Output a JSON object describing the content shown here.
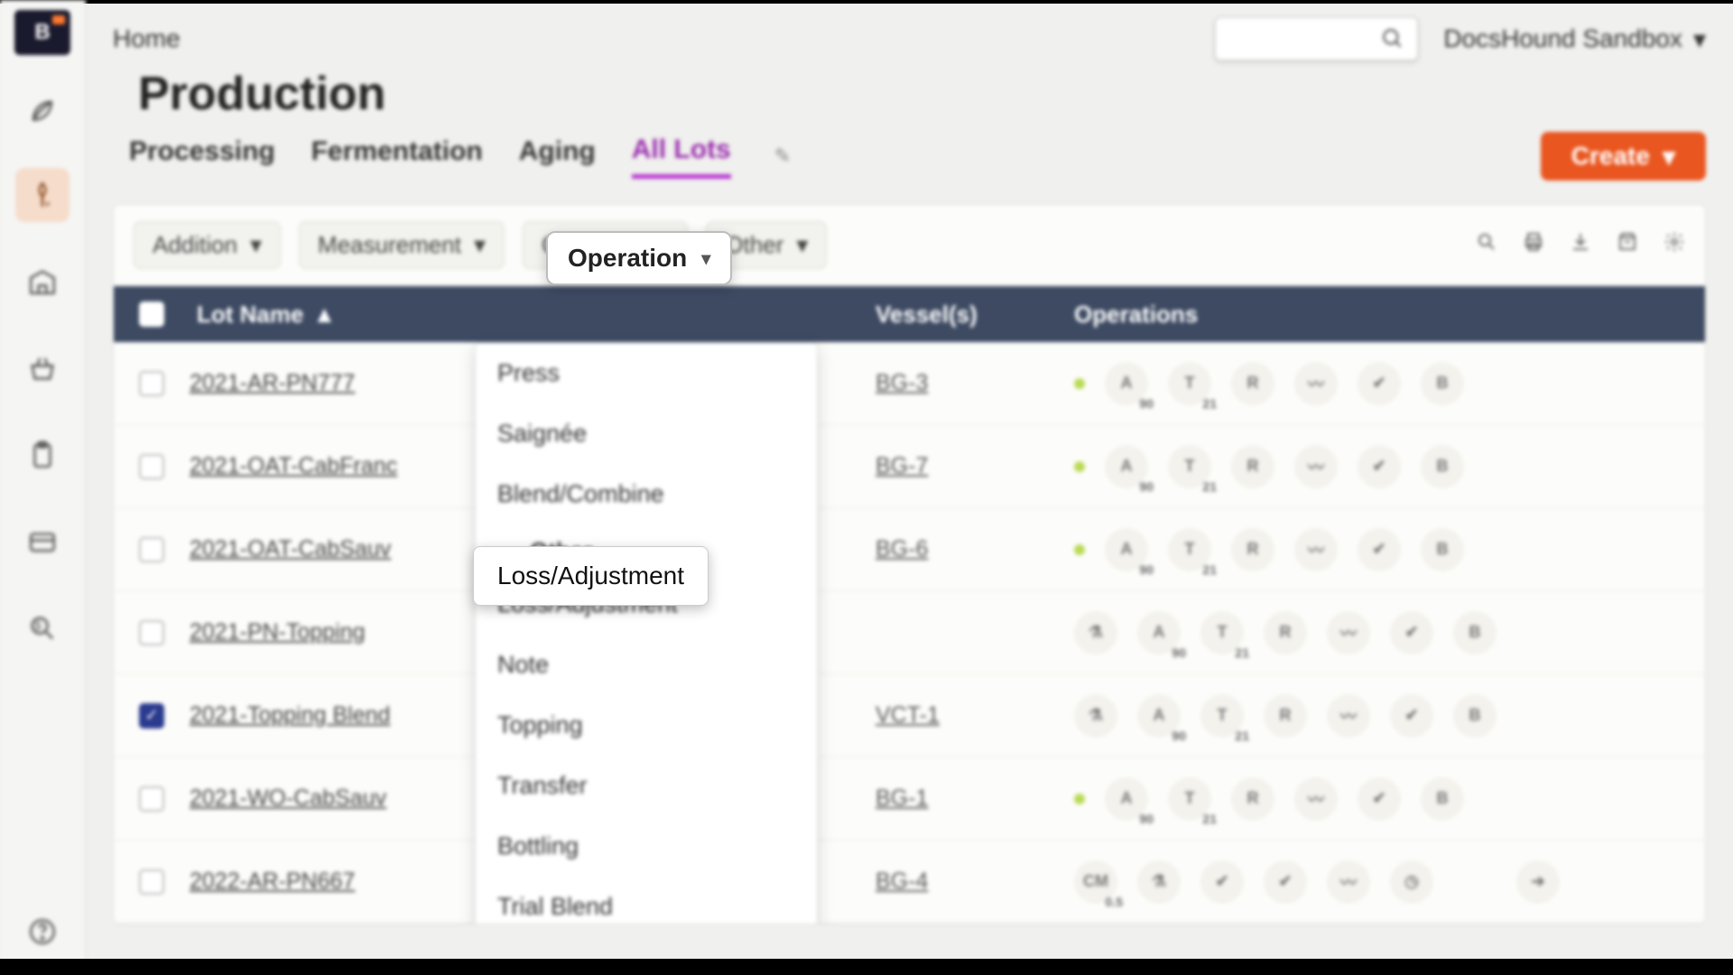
{
  "breadcrumb": "Home",
  "page_title": "Production",
  "org": {
    "name": "DocsHound Sandbox"
  },
  "search": {
    "placeholder": ""
  },
  "tabs": [
    {
      "label": "Processing",
      "active": false
    },
    {
      "label": "Fermentation",
      "active": false
    },
    {
      "label": "Aging",
      "active": false
    },
    {
      "label": "All Lots",
      "active": true
    }
  ],
  "create_button": "Create",
  "filters": {
    "addition": "Addition",
    "measurement": "Measurement",
    "operation": "Operation",
    "other": "Other"
  },
  "dropdown": {
    "section1": [
      "Press",
      "Saignée",
      "Blend/Combine"
    ],
    "heading": "Other",
    "section2": [
      "Loss/Adjustment",
      "Note",
      "Topping",
      "Transfer",
      "Bottling",
      "Trial Blend"
    ],
    "highlighted": "Loss/Adjustment"
  },
  "table": {
    "headers": {
      "lot_name": "Lot Name",
      "vessels": "Vessel(s)",
      "operations": "Operations"
    },
    "rows": [
      {
        "checked": false,
        "lot": "2021-AR-PN777",
        "vessel": "BG-3",
        "ops_variant": "std"
      },
      {
        "checked": false,
        "lot": "2021-OAT-CabFranc",
        "vessel": "BG-7",
        "ops_variant": "std"
      },
      {
        "checked": false,
        "lot": "2021-OAT-CabSauv",
        "vessel": "BG-6",
        "ops_variant": "std"
      },
      {
        "checked": false,
        "lot": "2021-PN-Topping",
        "vessel": "",
        "ops_variant": "std_extra"
      },
      {
        "checked": true,
        "lot": "2021-Topping Blend",
        "vessel": "VCT-1",
        "ops_variant": "std_extra"
      },
      {
        "checked": false,
        "lot": "2021-WO-CabSauv",
        "vessel": "BG-1",
        "ops_variant": "std"
      },
      {
        "checked": false,
        "lot": "2022-AR-PN667",
        "vessel": "BG-4",
        "ops_variant": "alt"
      }
    ]
  },
  "op_icons": {
    "std": [
      "green",
      "A/90",
      "T/21",
      "R",
      "line",
      "check",
      "B"
    ],
    "std_extra": [
      "flask",
      "A/90",
      "T/21",
      "R",
      "line",
      "check",
      "B"
    ],
    "alt": [
      "CM/0.5",
      "flask",
      "check",
      "check",
      "line",
      "clock",
      "",
      "arrow"
    ]
  },
  "sidebar_icons": [
    "leaf",
    "drop",
    "warehouse",
    "basket",
    "clipboard",
    "card",
    "zoom"
  ],
  "help_icon": "help"
}
